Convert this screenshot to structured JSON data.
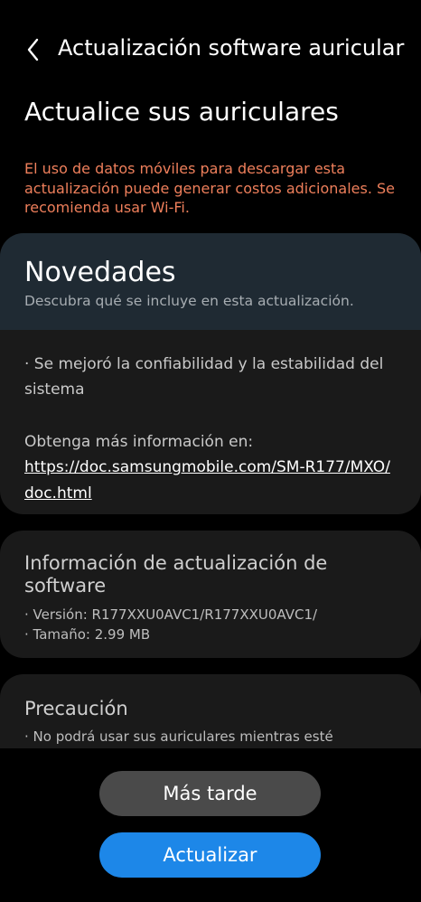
{
  "header": {
    "back_icon": "chevron-left-icon",
    "title": "Actualización software auricular"
  },
  "main": {
    "title": "Actualice sus auriculares",
    "warning": "El uso de datos móviles para descargar esta actualización puede generar costos adicionales. Se recomienda usar Wi-Fi.",
    "warning_color": "#ee7f5b"
  },
  "news": {
    "title": "Novedades",
    "subtitle": "Descubra qué se incluye en esta actualización.",
    "items": [
      "· Se mejoró la confiabilidad y la estabilidad del sistema"
    ],
    "more_label": "Obtenga más información en:",
    "link": "https://doc.samsungmobile.com/SM-R177/MXO/doc.html"
  },
  "software_info": {
    "title": "Información de actualización de software",
    "version": "· Versión: R177XXU0AVC1/R177XXU0AVC1/",
    "size": "· Tamaño: 2.99 MB"
  },
  "caution": {
    "title": "Precaución",
    "text": "· No podrá usar sus auriculares mientras esté"
  },
  "buttons": {
    "later": "Más tarde",
    "update": "Actualizar"
  },
  "colors": {
    "accent": "#1d87e8",
    "background": "#000000",
    "card": "#1a1a1a",
    "news_header": "#1f2a33"
  }
}
